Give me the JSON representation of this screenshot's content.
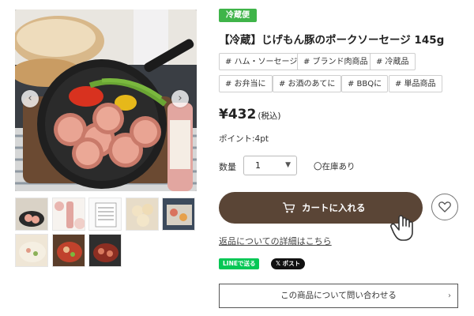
{
  "gallery": {
    "prev_icon": "‹",
    "next_icon": "›",
    "package_text": "じげもん豚",
    "package_sub": "長崎県産"
  },
  "product": {
    "badge": "冷蔵便",
    "title": "【冷蔵】じげもん豚のポークソーセージ 145g",
    "tags": [
      "# ハム・ソーセージ",
      "# ブランド肉商品",
      "# 冷蔵品",
      "# お弁当に",
      "# お酒のあてに",
      "# BBQに",
      "# 単品商品"
    ],
    "price": "¥432",
    "tax_note": "(税込)",
    "points": "ポイント:4pt"
  },
  "purchase": {
    "qty_label": "数量",
    "qty_value": "1",
    "stock": "〇在庫あり",
    "cart_label": "カートに入れる",
    "return_link": "返品についての詳細はこちら"
  },
  "share": {
    "line": "LINEで送る",
    "x": "𝕏 ポスト"
  },
  "inquiry": {
    "label": "この商品について問い合わせる",
    "arrow": "›"
  },
  "colors": {
    "badge_green": "#3fb449",
    "cart_brown": "#5a4536",
    "line_green": "#06c755"
  }
}
